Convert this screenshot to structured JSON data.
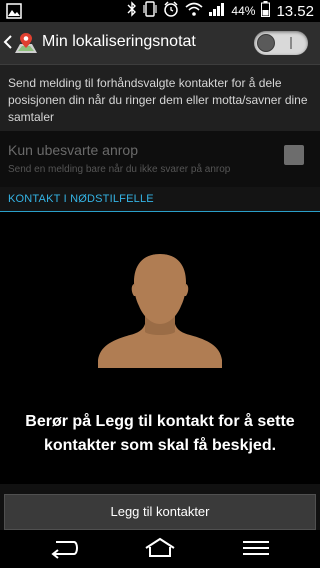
{
  "status_bar": {
    "battery_percent": "44%",
    "time": "13.52",
    "icons": [
      "image-notification-icon",
      "bluetooth-icon",
      "vibrate-icon",
      "alarm-icon",
      "wifi-icon",
      "signal-icon",
      "battery-icon"
    ]
  },
  "header": {
    "title": "Min lokaliseringsnotat",
    "toggle_on": false,
    "app_icon": "map-pin-icon"
  },
  "description": "Send melding til forhåndsvalgte kontakter for å dele posisjonen din når du ringer dem eller motta/savner dine samtaler",
  "missed_calls": {
    "title": "Kun ubesvarte anrop",
    "subtitle": "Send en melding bare når du ikke svarer på anrop",
    "checked": false
  },
  "section": {
    "label": "KONTAKT I NØDSTILFELLE"
  },
  "empty_state": {
    "message": "Berør på Legg til kontakt for å sette kontakter som skal få beskjed.",
    "icon": "person-silhouette-icon"
  },
  "add_button_label": "Legg til kontakter",
  "navigation": [
    "back-icon",
    "home-icon",
    "menu-icon"
  ],
  "colors": {
    "accent": "#34b3e4",
    "avatar": "#b07d53"
  }
}
